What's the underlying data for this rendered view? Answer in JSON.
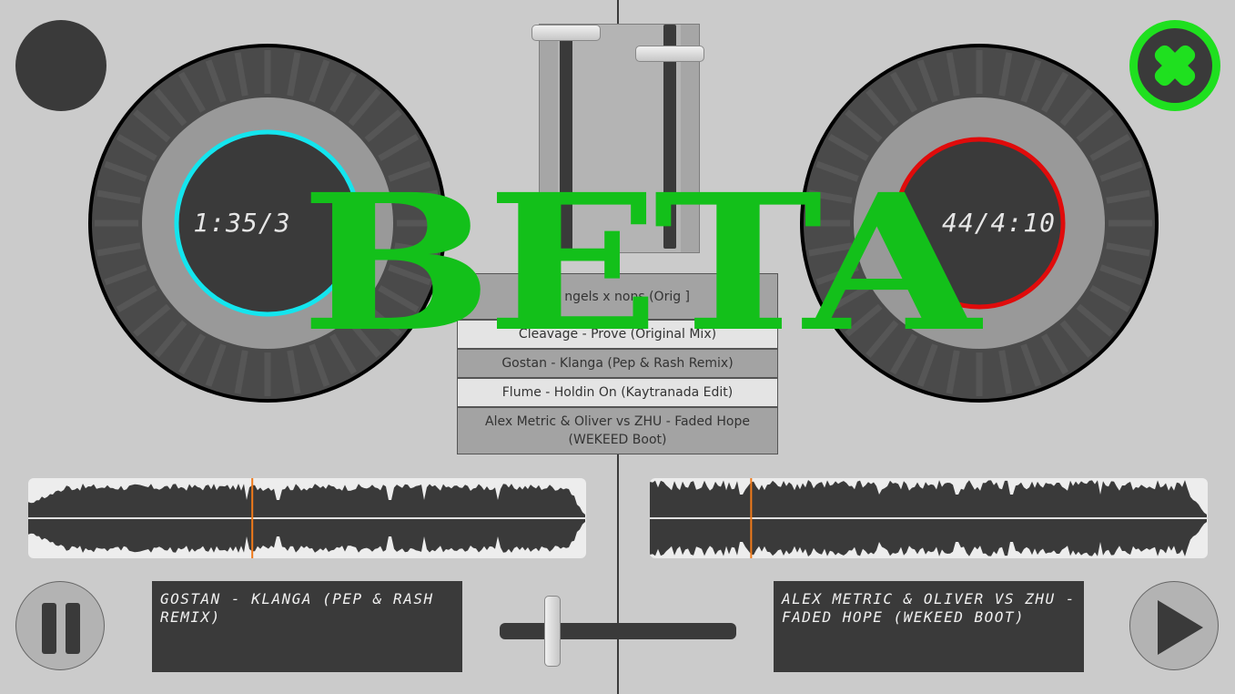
{
  "deck_left": {
    "time_readout": "1:35/3",
    "ring_color": "#14e5ee",
    "track_title": "GOSTAN - KLANGA (PEP & RASH REMIX)",
    "waveform_position": 0.4,
    "control": "pause"
  },
  "deck_right": {
    "time_readout": "44/4:10",
    "ring_color": "#e00b0b",
    "track_title": "ALEX METRIC & OLIVER VS ZHU - FADED HOPE (WEKEED BOOT)",
    "waveform_position": 0.18,
    "control": "play"
  },
  "playlist": [
    {
      "label": "Jul    ngels x    nons (Orig           ]",
      "style": "dark"
    },
    {
      "label": "Cleavage - Prove (Original Mix)",
      "style": "light"
    },
    {
      "label": "Gostan - Klanga (Pep & Rash Remix)",
      "style": "dark"
    },
    {
      "label": "Flume - Holdin On (Kaytranada Edit)",
      "style": "light"
    },
    {
      "label": "Alex Metric & Oliver vs ZHU - Faded Hope (WEKEED Boot)",
      "style": "dark"
    }
  ],
  "overlay": {
    "label": "BETA",
    "color": "#13c01a"
  },
  "icons": {
    "record": "record-icon",
    "close": "close-icon",
    "pause": "pause-icon",
    "play": "play-icon"
  },
  "colors": {
    "accent_close": "#1fe01f",
    "playhead": "#f07a1a"
  }
}
